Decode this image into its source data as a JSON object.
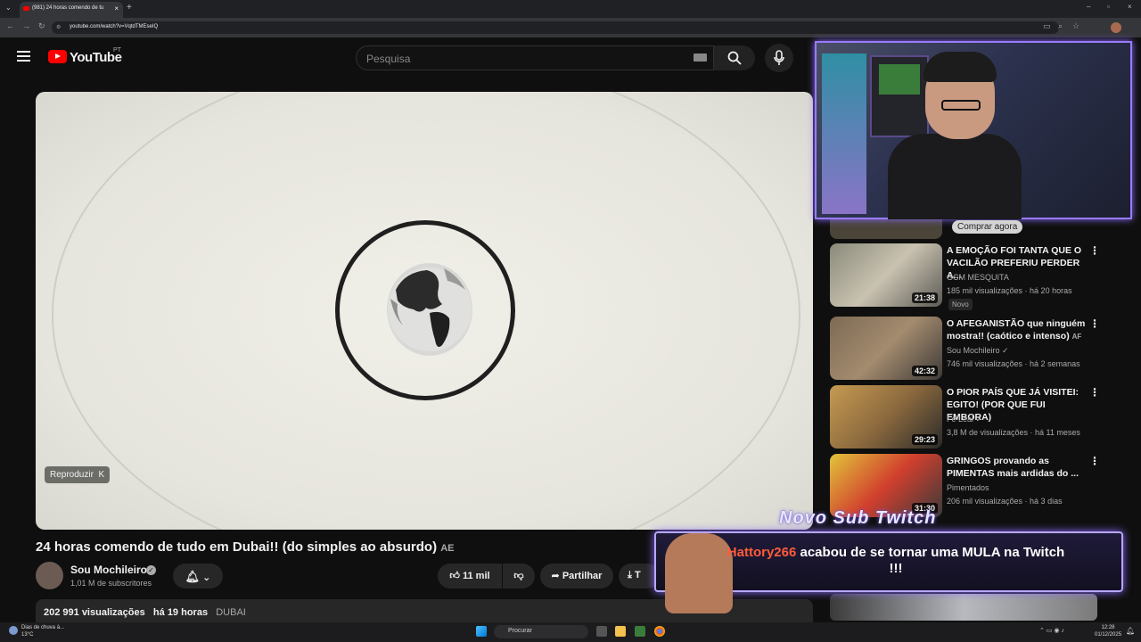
{
  "browser": {
    "tab_title": "(981) 24 horas comendo de tu",
    "url": "youtube.com/watch?v=VqtdTMEseIQ"
  },
  "header": {
    "logo_text": "YouTube",
    "region": "PT",
    "search_placeholder": "Pesquisa"
  },
  "player": {
    "replay_label": "Reproduzir",
    "replay_key": "K"
  },
  "video": {
    "title": "24 horas comendo de tudo em Dubai!! (do simples ao absurdo)",
    "title_flag": "AE",
    "channel": "Sou Mochileiro",
    "subscribers": "1,01 M de subscritores",
    "likes": "11 mil",
    "share_label": "Partilhar",
    "download_partial": "T",
    "views": "202 991 visualizações",
    "age": "há 19 horas",
    "tag": "DUBAI"
  },
  "overlay": {
    "comprar": "Comprar agora",
    "alert_heading": "Novo Sub Twitch",
    "alert_user": "Hattory266",
    "alert_message": "acabou de se tornar uma MULA na Twitch",
    "alert_suffix": "!!!"
  },
  "recommendations": [
    {
      "title": "A EMOÇÃO FOI TANTA QUE O VACILÃO PREFERIU PERDER A...",
      "channel": "GCM MESQUITA",
      "views": "185 mil visualizações",
      "age": "há 20 horas",
      "duration": "21:38",
      "badge": "Novo"
    },
    {
      "title": "O AFEGANISTÃO que ninguém mostra!! (caótico e intenso)",
      "flag": "AF",
      "channel": "Sou Mochileiro",
      "views": "746 mil visualizações",
      "age": "há 2 semanas",
      "duration": "42:32"
    },
    {
      "title": "O PIOR PAÍS QUE JÁ VISITEI: EGITO! (POR QUE FUI EMBORA)",
      "channel": "Fe Leal",
      "views": "3,8 M de visualizações",
      "age": "há 11 meses",
      "duration": "29:23"
    },
    {
      "title": "GRINGOS provando as PIMENTAS mais ardidas do ...",
      "channel": "Pimentados",
      "views": "206 mil visualizações",
      "age": "há 3 dias",
      "duration": "31:30"
    }
  ],
  "taskbar": {
    "search": "Procurar",
    "weather_line1": "Dias de chuva à...",
    "weather_line2": "13°C",
    "time": "12:28",
    "date": "01/12/2025"
  },
  "colors": {
    "accent": "#ff0000",
    "overlay_purple": "#9a7bff"
  }
}
